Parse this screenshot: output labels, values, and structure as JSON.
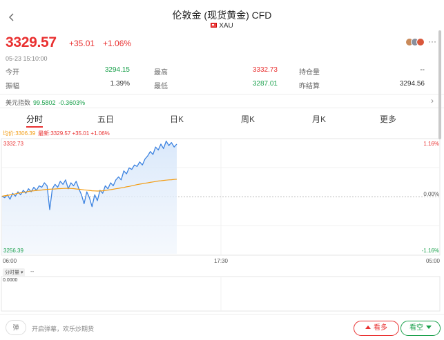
{
  "header": {
    "title": "伦敦金 (现货黄金) CFD",
    "subtitle": "XAU"
  },
  "quote": {
    "price": "3329.57",
    "change": "+35.01",
    "change_pct": "+1.06%",
    "timestamp": "05-23 15:10:00"
  },
  "stats": {
    "open_label": "今开",
    "open_value": "3294.15",
    "high_label": "最高",
    "high_value": "3332.73",
    "oi_label": "持仓量",
    "oi_value": "--",
    "amplitude_label": "振幅",
    "amplitude_value": "1.39%",
    "low_label": "最低",
    "low_value": "3287.01",
    "prev_settle_label": "昨结算",
    "prev_settle_value": "3294.56"
  },
  "index": {
    "label": "美元指数",
    "value": "99.5802",
    "change_pct": "-0.3603%"
  },
  "tabs": [
    {
      "label": "分时"
    },
    {
      "label": "五日"
    },
    {
      "label": "日K"
    },
    {
      "label": "周K"
    },
    {
      "label": "月K"
    },
    {
      "label": "更多"
    }
  ],
  "legend": {
    "avg": "均价:3306.39",
    "latest": "最新:3329.57 +35.01 +1.06%"
  },
  "chart_data": {
    "type": "line",
    "y_ticks_left": [
      "3332.73",
      "3256.39"
    ],
    "y_ticks_right": [
      "1.16%",
      "0.00%",
      "-1.16%"
    ],
    "x_ticks": [
      "06:00",
      "17:30",
      "05:00"
    ],
    "ylim": [
      3256.39,
      3332.73
    ],
    "reference": 3294.56,
    "series": [
      {
        "values": [
          3295,
          3294,
          3296,
          3293,
          3297,
          3295,
          3298,
          3296,
          3299,
          3297,
          3300,
          3298,
          3301,
          3299,
          3302,
          3301,
          3304,
          3302,
          3286,
          3300,
          3303,
          3301,
          3305,
          3303,
          3306,
          3300,
          3304,
          3302,
          3305,
          3300,
          3296,
          3290,
          3298,
          3294,
          3288,
          3296,
          3292,
          3299,
          3297,
          3302,
          3300,
          3304,
          3302,
          3306,
          3308,
          3306,
          3312,
          3310,
          3314,
          3313,
          3316,
          3315,
          3318,
          3316,
          3320,
          3322,
          3325,
          3323,
          3328,
          3326,
          3330,
          3327,
          3332,
          3329,
          3331,
          3328,
          3330
        ]
      },
      {
        "values": [
          3295,
          3295.3,
          3295.6,
          3295.9,
          3296.2,
          3296.6,
          3297,
          3297.3,
          3297.6,
          3297.9,
          3298.2,
          3298.5,
          3298.7,
          3298.9,
          3299,
          3299.2,
          3299.4,
          3299.6,
          3299.7,
          3299.8,
          3299.9,
          3300,
          3300.1,
          3300.2,
          3300.3,
          3300.3,
          3300.2,
          3300.1,
          3299.9,
          3299.7,
          3299.5,
          3299.3,
          3299.1,
          3298.9,
          3298.7,
          3298.6,
          3298.5,
          3298.6,
          3298.7,
          3298.9,
          3299.1,
          3299.4,
          3299.7,
          3300,
          3300.3,
          3300.6,
          3300.9,
          3301.3,
          3301.6,
          3302,
          3302.4,
          3302.8,
          3303.1,
          3303.4,
          3303.7,
          3304,
          3304.3,
          3304.6,
          3304.9,
          3305.2,
          3305.4,
          3305.6,
          3305.8,
          3306,
          3306.1,
          3306.3,
          3306.39
        ]
      }
    ],
    "volume_label": "分时量",
    "volume_dash": "--",
    "volume_value": "0.0000"
  },
  "bottom": {
    "danmu_icon": "弹",
    "danmu_hint": "开启弹幕，欢乐炒期货",
    "bull_label": "看多",
    "bear_label": "看空"
  },
  "colors": {
    "up": "#e93030",
    "down": "#19a04b",
    "price_line": "#3b82e0",
    "avg_line": "#f39c12"
  }
}
